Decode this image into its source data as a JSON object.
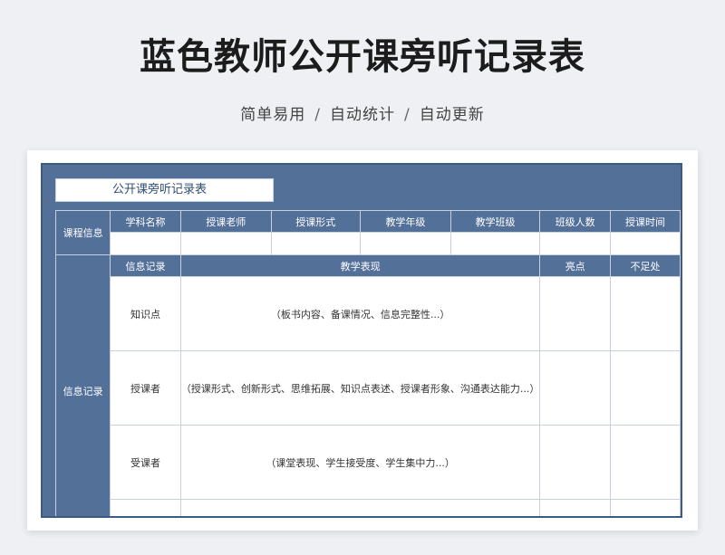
{
  "page": {
    "title": "蓝色教师公开课旁听记录表",
    "subtitle_parts": [
      "简单易用",
      "自动统计",
      "自动更新"
    ],
    "separator": "/"
  },
  "sheet": {
    "title": "公开课旁听记录表",
    "course_info_label": "课程信息",
    "course_columns": [
      "学科名称",
      "授课老师",
      "授课形式",
      "教学年级",
      "教学班级",
      "班级人数",
      "授课时间"
    ],
    "record_section_label": "信息记录",
    "record_columns": [
      "信息记录",
      "教学表现",
      "亮点",
      "不足处"
    ],
    "rows": [
      {
        "label": "知识点",
        "performance": "（板书内容、备课情况、信息完整性...）"
      },
      {
        "label": "授课者",
        "performance": "（授课形式、创新形式、思维拓展、知识点表述、授课者形象、沟通表达能力...）"
      },
      {
        "label": "受课者",
        "performance": "（课堂表现、学生接受度、学生集中力...）"
      },
      {
        "label": "",
        "performance": ""
      }
    ]
  },
  "colors": {
    "header_blue": "#537099",
    "background": "#eef0f3"
  }
}
